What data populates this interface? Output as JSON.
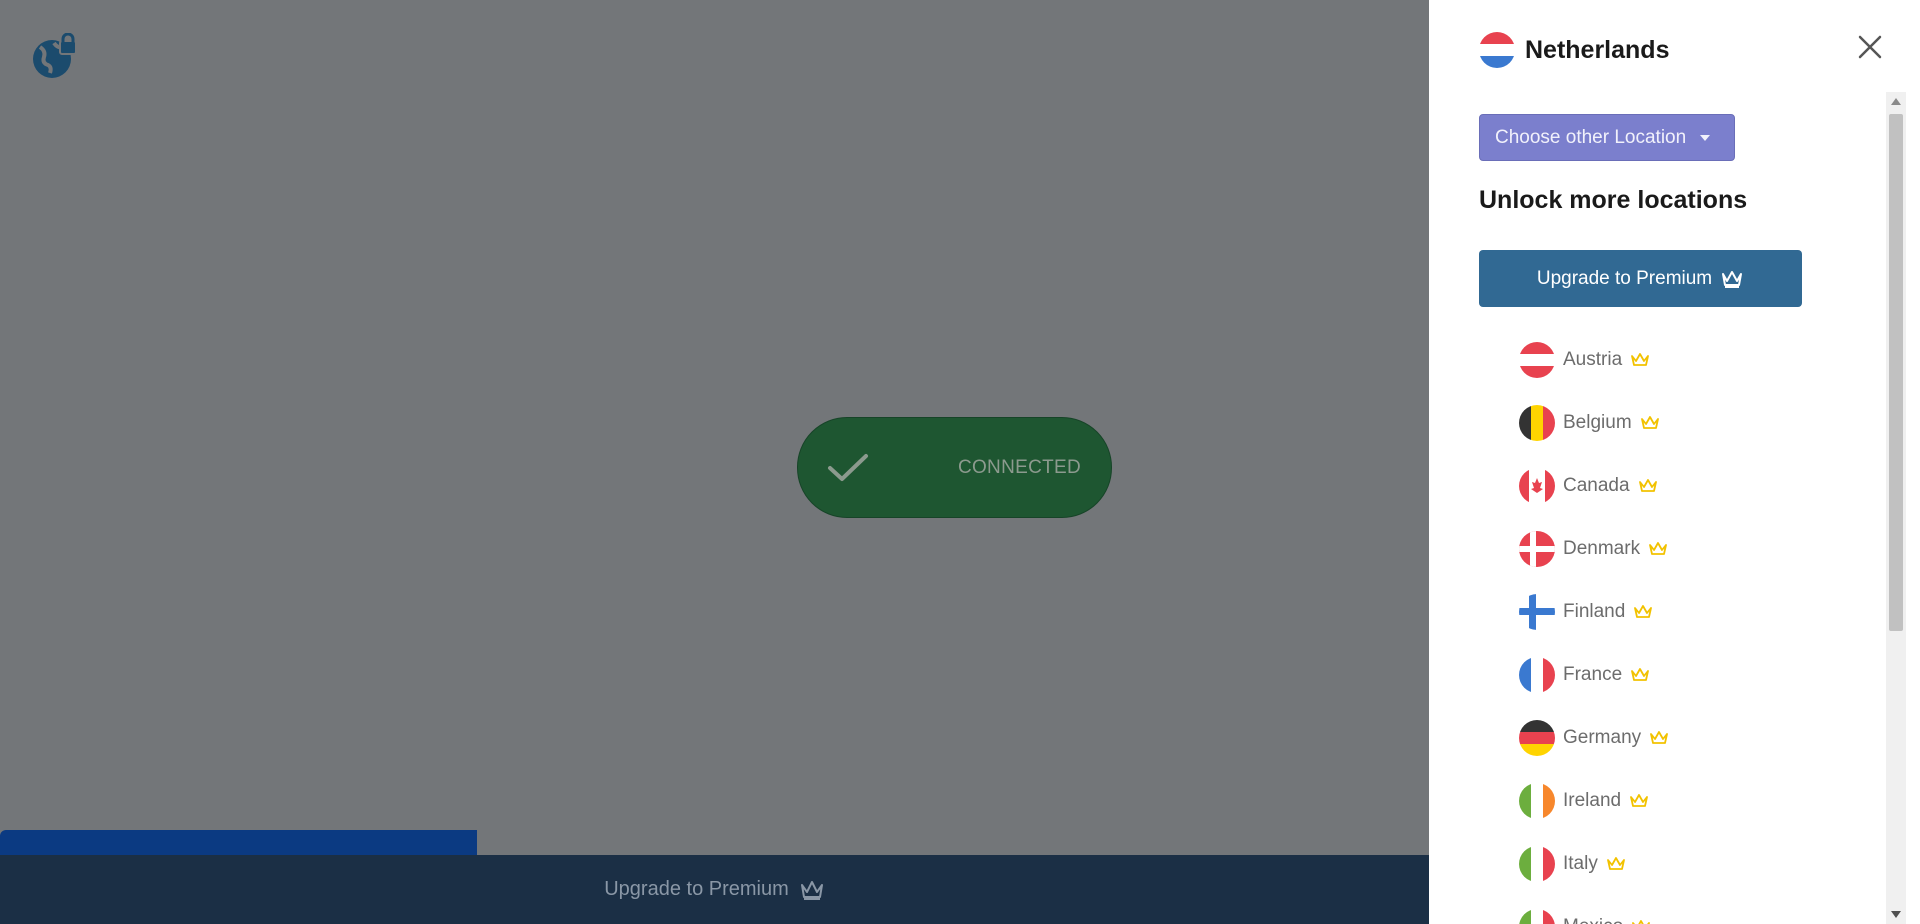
{
  "app": {
    "logo_icon": "globe-lock-icon"
  },
  "status": {
    "label": "CONNECTED",
    "icon": "checkmark-icon",
    "color": "#1e5631"
  },
  "bottom_bar": {
    "upgrade_label": "Upgrade to Premium",
    "icon": "crown-icon"
  },
  "panel": {
    "current_location": "Netherlands",
    "current_flag": "netherlands-flag",
    "choose_location_label": "Choose other Location",
    "unlock_heading": "Unlock more locations",
    "upgrade_label": "Upgrade to Premium",
    "countries": [
      {
        "name": "Austria",
        "flag": "austria-flag",
        "premium": true
      },
      {
        "name": "Belgium",
        "flag": "belgium-flag",
        "premium": true
      },
      {
        "name": "Canada",
        "flag": "canada-flag",
        "premium": true
      },
      {
        "name": "Denmark",
        "flag": "denmark-flag",
        "premium": true
      },
      {
        "name": "Finland",
        "flag": "finland-flag",
        "premium": true
      },
      {
        "name": "France",
        "flag": "france-flag",
        "premium": true
      },
      {
        "name": "Germany",
        "flag": "germany-flag",
        "premium": true
      },
      {
        "name": "Ireland",
        "flag": "ireland-flag",
        "premium": true
      },
      {
        "name": "Italy",
        "flag": "italy-flag",
        "premium": true
      },
      {
        "name": "Mexico",
        "flag": "mexico-flag",
        "premium": true
      }
    ]
  },
  "colors": {
    "overlay": "#737679",
    "accent_button": "#7b7fcd",
    "premium_button": "#316993",
    "bottom_bar": "#1b2f45",
    "crown": "#f2c200"
  }
}
